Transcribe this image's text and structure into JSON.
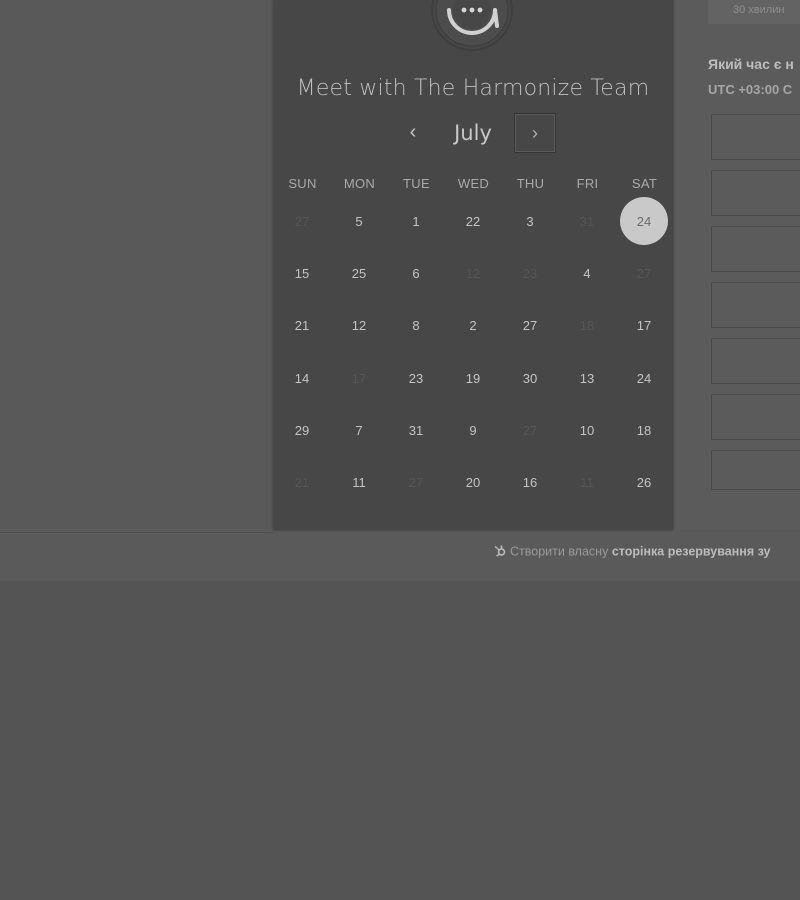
{
  "meeting": {
    "title": "Meet with The Harmonize Team"
  },
  "calendar": {
    "month": "July",
    "prev_label": "‹",
    "next_label": "›",
    "weekdays": [
      "SUN",
      "MON",
      "TUE",
      "WED",
      "THU",
      "FRI",
      "SAT"
    ],
    "weeks": [
      [
        {
          "d": "27",
          "off": true
        },
        {
          "d": "5"
        },
        {
          "d": "1"
        },
        {
          "d": "22"
        },
        {
          "d": "3"
        },
        {
          "d": "31",
          "off": true
        },
        {
          "d": "24",
          "selected": true
        }
      ],
      [
        {
          "d": "15"
        },
        {
          "d": "25"
        },
        {
          "d": "6"
        },
        {
          "d": "12",
          "off": true
        },
        {
          "d": "23",
          "off": true
        },
        {
          "d": "4"
        },
        {
          "d": "27",
          "off": true
        }
      ],
      [
        {
          "d": "21"
        },
        {
          "d": "12"
        },
        {
          "d": "8"
        },
        {
          "d": "2"
        },
        {
          "d": "27"
        },
        {
          "d": "18",
          "off": true
        },
        {
          "d": "17"
        }
      ],
      [
        {
          "d": "14"
        },
        {
          "d": "17",
          "off": true
        },
        {
          "d": "23"
        },
        {
          "d": "19"
        },
        {
          "d": "30"
        },
        {
          "d": "13"
        },
        {
          "d": "24"
        }
      ],
      [
        {
          "d": "29"
        },
        {
          "d": "7"
        },
        {
          "d": "31"
        },
        {
          "d": "9"
        },
        {
          "d": "27",
          "off": true
        },
        {
          "d": "10"
        },
        {
          "d": "18"
        }
      ],
      [
        {
          "d": "21",
          "off": true
        },
        {
          "d": "11"
        },
        {
          "d": "27",
          "off": true
        },
        {
          "d": "20"
        },
        {
          "d": "16"
        },
        {
          "d": "11",
          "off": true
        },
        {
          "d": "26"
        }
      ]
    ]
  },
  "times": {
    "duration": "30 хвилин",
    "question": "Який час є н",
    "timezone": "UTC +03:00 С",
    "slot_count": 7
  },
  "footer": {
    "text": "Створити власну",
    "bold": "сторінка резервування зу"
  },
  "colors": {
    "selected_day": "#c9c9c9",
    "card_bg": "#474747",
    "page_bg": "#545454"
  }
}
